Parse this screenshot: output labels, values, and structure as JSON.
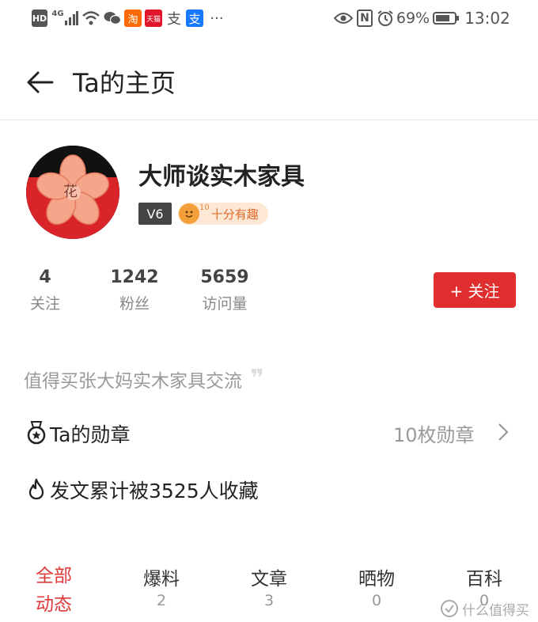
{
  "status": {
    "network": "4G",
    "battery": "69%",
    "time": "13:02",
    "more": "···",
    "taobao": "淘",
    "tmall": "天猫",
    "alipay1": "支",
    "alipay2": "支"
  },
  "header": {
    "title": "Ta的主页"
  },
  "profile": {
    "name": "大师谈实木家具",
    "level": "V6",
    "fun_badge": "十分有趣",
    "fun_badge_num": "10",
    "avatar_char": "花"
  },
  "stats": [
    {
      "value": "4",
      "label": "关注"
    },
    {
      "value": "1242",
      "label": "粉丝"
    },
    {
      "value": "5659",
      "label": "访问量"
    }
  ],
  "follow_label": "+ 关注",
  "signature": "值得买张大妈实木家具交流",
  "medals": {
    "label": "Ta的勋章",
    "count": "10枚勋章"
  },
  "favorites": "发文累计被3525人收藏",
  "tabs": [
    {
      "l1": "全部",
      "l2": "动态"
    },
    {
      "label": "爆料",
      "count": "2"
    },
    {
      "label": "文章",
      "count": "3"
    },
    {
      "label": "晒物",
      "count": "0"
    },
    {
      "label": "百科",
      "count": "0"
    }
  ],
  "watermark": "什么值得买",
  "colors": {
    "accent": "#e02e2e",
    "tab_active": "#e03a3a"
  }
}
